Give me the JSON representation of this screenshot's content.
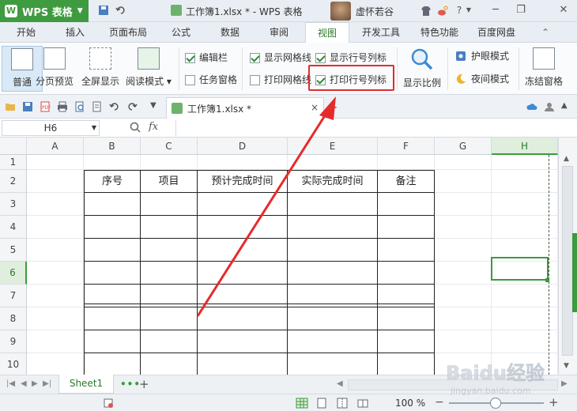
{
  "titlebar": {
    "app_name": "WPS 表格",
    "document_title": "工作簿1.xlsx * - WPS 表格",
    "username": "虚怀若谷",
    "help_label": "?"
  },
  "tabs": [
    "开始",
    "插入",
    "页面布局",
    "公式",
    "数据",
    "审阅",
    "视图",
    "开发工具",
    "特色功能",
    "百度网盘"
  ],
  "active_tab": "视图",
  "ribbon": {
    "normal_view": "普通",
    "page_break_preview": "分页预览",
    "full_screen": "全屏显示",
    "reading_mode": "阅读模式",
    "edit_bar": "编辑栏",
    "task_pane": "任务窗格",
    "show_gridlines": "显示网格线",
    "print_gridlines": "打印网格线",
    "show_row_col_headers": "显示行号列标",
    "print_row_col_headers": "打印行号列标",
    "zoom": "显示比例",
    "eye_protection": "护眼模式",
    "night_mode": "夜间模式",
    "freeze_panes": "冻结窗格",
    "checked": {
      "edit_bar": true,
      "task_pane": false,
      "show_gridlines": true,
      "print_gridlines": false,
      "show_row_col_headers": true,
      "print_row_col_headers": true
    }
  },
  "file_tab": {
    "name": "工作簿1.xlsx *",
    "close": "×",
    "add": "+"
  },
  "formula_bar": {
    "cell_ref": "H6",
    "fx": "fx",
    "value": ""
  },
  "sheet": {
    "columns": [
      "A",
      "B",
      "C",
      "D",
      "E",
      "F",
      "G",
      "H"
    ],
    "rows": [
      "1",
      "2",
      "3",
      "4",
      "5",
      "6",
      "7",
      "8",
      "9",
      "10"
    ],
    "selected_column": "H",
    "selected_row": "6",
    "table_headers": [
      "序号",
      "项目",
      "预计完成时间",
      "实际完成时间",
      "备注"
    ]
  },
  "sheet_tabs": {
    "name": "Sheet1",
    "dots": "•••",
    "add": "+"
  },
  "status": {
    "zoom": "100 %"
  },
  "colors": {
    "brand_green": "#3f9b3f",
    "highlight_red": "#e52b2b",
    "selection_green": "#3c9b3c"
  },
  "watermark": {
    "text": "Baidu经验",
    "url": "jingyan.baidu.com"
  }
}
